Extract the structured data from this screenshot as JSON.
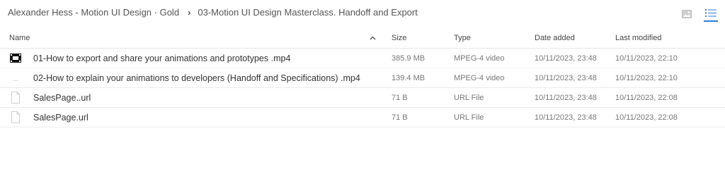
{
  "breadcrumb": {
    "root": "Alexander Hess - Motion UI Design · Gold",
    "current": "03-Motion UI Design Masterclass. Handoff and Export"
  },
  "view": {
    "thumbnail_icon": "image-icon",
    "list_icon": "list-icon",
    "active": "list"
  },
  "columns": {
    "name": "Name",
    "size": "Size",
    "type": "Type",
    "date_added": "Date added",
    "last_modified": "Last modified"
  },
  "files": [
    {
      "name": "01-How to export and share your animations and prototypes .mp4",
      "size": "385.9 MB",
      "type": "MPEG-4 video",
      "date_added": "10/11/2023, 23:48",
      "last_modified": "10/11/2023, 22:10",
      "icon": "video-thumbnail-icon"
    },
    {
      "name": "02-How to explain your animations to developers (Handoff and Specifications) .mp4",
      "size": "139.4 MB",
      "type": "MPEG-4 video",
      "date_added": "10/11/2023, 23:48",
      "last_modified": "10/11/2023, 22:10",
      "icon": "video-thumbnail-icon"
    },
    {
      "name": "SalesPage..url",
      "size": "71 B",
      "type": "URL File",
      "date_added": "10/11/2023, 23:48",
      "last_modified": "10/11/2023, 22:08",
      "icon": "file-icon"
    },
    {
      "name": "SalesPage.url",
      "size": "71 B",
      "type": "URL File",
      "date_added": "10/11/2023, 23:48",
      "last_modified": "10/11/2023, 22:08",
      "icon": "file-icon"
    }
  ],
  "colors": {
    "accent": "#2b7ed8",
    "row_border": "#ececec"
  }
}
